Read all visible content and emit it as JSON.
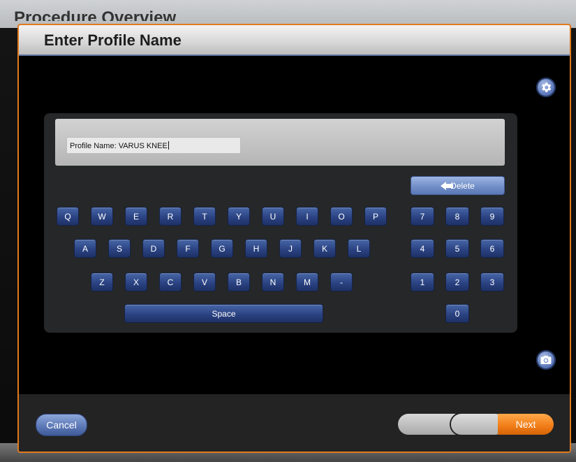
{
  "background": {
    "title": "Procedure Overview"
  },
  "dialog": {
    "title": "Enter Profile Name",
    "gear_icon": "gear-icon",
    "camera_icon": "camera-icon",
    "accent_color": "#e07a1e"
  },
  "profile_field": {
    "label": "Profile Name:",
    "value": "VARUS KNEE"
  },
  "keyboard": {
    "delete_label": "Delete",
    "space_label": "Space",
    "row1": [
      "Q",
      "W",
      "E",
      "R",
      "T",
      "Y",
      "U",
      "I",
      "O",
      "P"
    ],
    "row2": [
      "A",
      "S",
      "D",
      "F",
      "G",
      "H",
      "J",
      "K",
      "L"
    ],
    "row3": [
      "Z",
      "X",
      "C",
      "V",
      "B",
      "N",
      "M",
      "-"
    ],
    "numpad": [
      [
        "7",
        "8",
        "9"
      ],
      [
        "4",
        "5",
        "6"
      ],
      [
        "1",
        "2",
        "3"
      ],
      [
        "0"
      ]
    ],
    "key_color": "#2b4383"
  },
  "footer": {
    "cancel_label": "Cancel",
    "next_label": "Next",
    "next_color": "#f07c17"
  }
}
